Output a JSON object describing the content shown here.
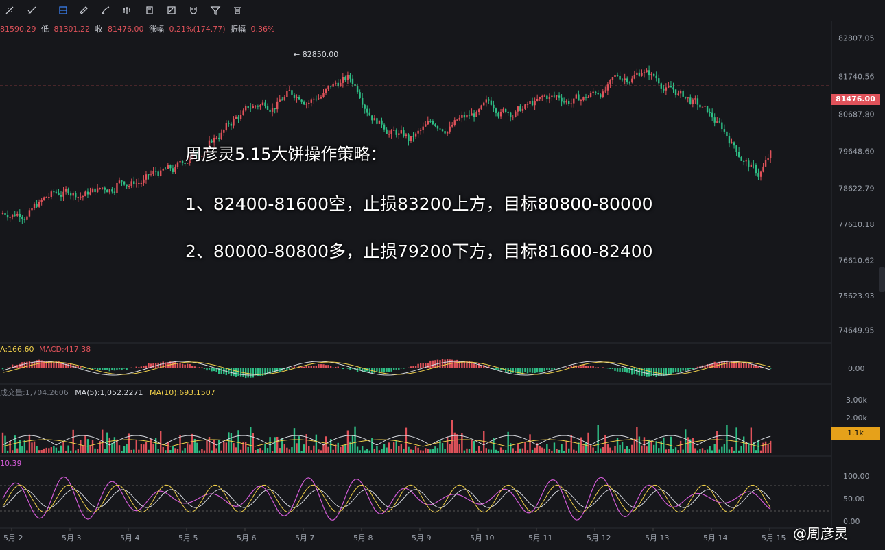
{
  "toolbar": {
    "icons": [
      "crosshair-icon",
      "trend-line-icon",
      "fib-icon",
      "ruler-icon",
      "brush-icon",
      "bars-pattern-icon",
      "note-icon",
      "text-edit-icon",
      "magnet-icon",
      "filter-icon",
      "trash-icon"
    ]
  },
  "ohlc": {
    "high_value": "81590.29",
    "low_label": "低",
    "low_value": "81301.22",
    "close_label": "收",
    "close_value": "81476.00",
    "change_label": "涨幅",
    "change_value": "0.21%(174.77)",
    "amplitude_label": "振幅",
    "amplitude_value": "0.36%"
  },
  "price_axis": {
    "ticks": [
      "82807.05",
      "81740.56",
      "80687.80",
      "79648.60",
      "78622.79",
      "77610.18",
      "76610.62",
      "75623.93",
      "74649.95"
    ],
    "current_price": "81476.00",
    "peak_label": "← 82850.00"
  },
  "time_axis": {
    "ticks": [
      "5月 2",
      "5月 3",
      "5月 4",
      "5月 5",
      "5月 6",
      "5月 7",
      "5月 8",
      "5月 9",
      "5月 10",
      "5月 11",
      "5月 12",
      "5月 13",
      "5月 14",
      "5月 15"
    ]
  },
  "macd": {
    "label_a": "A:166.60",
    "label_macd": "MACD:417.38",
    "axis_tick": "0.00"
  },
  "volume": {
    "label_vol": "成交量:1,704.2606",
    "label_ma5": "MA(5):1,052.2271",
    "label_ma10": "MA(10):693.1507",
    "axis_ticks": [
      "3.00k",
      "2.00k"
    ],
    "current_tag": "1.1k"
  },
  "kdj": {
    "label": "10.39",
    "axis_ticks": [
      "100.00",
      "50.00",
      "0.00"
    ]
  },
  "strategy": {
    "title": "周彦灵5.15大饼操作策略：",
    "line1": "1、82400-81600空，止损83200上方，目标80800-80000",
    "line2": "2、80000-80800多，止损79200下方，目标81600-82400"
  },
  "watermark": "@周彦灵",
  "colors": {
    "up": "#e0525a",
    "down": "#2ebd85",
    "bg": "#16171b",
    "ma_yellow": "#f0d04a",
    "kdj_pink": "#d25bd6"
  },
  "chart_data": {
    "type": "candlestick",
    "title": "",
    "x": [
      "5月 2",
      "5月 3",
      "5月 4",
      "5月 5",
      "5月 6",
      "5月 7",
      "5月 8",
      "5月 9",
      "5月 10",
      "5月 11",
      "5月 12",
      "5月 13",
      "5月 14",
      "5月 15"
    ],
    "series": [
      {
        "name": "",
        "close": [
          78500,
          78700,
          79100,
          80500,
          81300,
          81700,
          80000,
          80600,
          80850,
          81100,
          81900,
          80900,
          79000,
          81476
        ]
      }
    ],
    "ylim": [
      74300,
      83300
    ],
    "current_price": 81476.0,
    "peak": 82850.0
  }
}
